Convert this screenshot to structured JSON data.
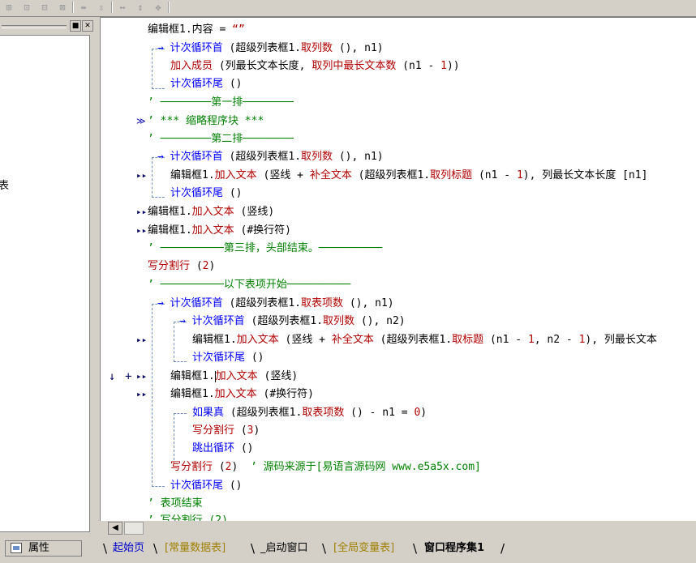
{
  "toolbar": {
    "icons": [
      "align-grid-icon",
      "align-top-icon",
      "align-middle-icon",
      "align-bottom-icon",
      "space-horizontal-icon",
      "space-vertical-icon",
      "width-icon",
      "height-icon",
      "size-both-icon"
    ]
  },
  "left_panel": {
    "stray_char": "表",
    "property_tab": "属性"
  },
  "tabs": [
    {
      "label": "起始页",
      "color": "#0000cc"
    },
    {
      "label": "[常量数据表]",
      "color": "#a08000"
    },
    {
      "label": "_启动窗口",
      "color": "#000000"
    },
    {
      "label": "[全局变量表]",
      "color": "#a08000"
    },
    {
      "label": "窗口程序集1",
      "color": "#000000",
      "active": true
    }
  ],
  "code": {
    "l1": {
      "a": "编辑框1.内容 = ",
      "b": "“”"
    },
    "l2": {
      "a": "计次循环首",
      "b": " (超级列表框1.",
      "c": "取列数",
      "d": " (), n1)"
    },
    "l3": {
      "a": "加入成员",
      "b": " (列最长文本长度, ",
      "c": "取列中最长文本数",
      "d": " (n1 - ",
      "e": "1",
      "f": "))"
    },
    "l4": {
      "a": "计次循环尾",
      "b": " ()"
    },
    "l5": {
      "a": "’ ────────第一排────────"
    },
    "l6": {
      "a": "’ *** 缩略程序块 ***"
    },
    "l7": {
      "a": "’ ────────第二排────────"
    },
    "l8": {
      "a": "计次循环首",
      "b": " (超级列表框1.",
      "c": "取列数",
      "d": " (), n1)"
    },
    "l9": {
      "a": "编辑框1.",
      "b": "加入文本",
      "c": " (竖线 + ",
      "d": "补全文本",
      "e": " (超级列表框1.",
      "f": "取列标题",
      "g": " (n1 - ",
      "h": "1",
      "i": "), 列最长文本长度 [n1]"
    },
    "l10": {
      "a": "计次循环尾",
      "b": " ()"
    },
    "l11": {
      "a": "编辑框1.",
      "b": "加入文本",
      "c": " (竖线)"
    },
    "l12": {
      "a": "编辑框1.",
      "b": "加入文本",
      "c": " (#换行符)"
    },
    "l13": {
      "a": "’ ──────────第三排，头部结束。──────────"
    },
    "l14": {
      "a": "写分割行",
      "b": " (",
      "c": "2",
      "d": ")"
    },
    "l15": {
      "a": "’ ──────────以下表项开始──────────"
    },
    "l16": {
      "a": "计次循环首",
      "b": " (超级列表框1.",
      "c": "取表项数",
      "d": " (), n1)"
    },
    "l17": {
      "a": "计次循环首",
      "b": " (超级列表框1.",
      "c": "取列数",
      "d": " (), n2)"
    },
    "l18": {
      "a": "编辑框1.",
      "b": "加入文本",
      "c": " (竖线 + ",
      "d": "补全文本",
      "e": " (超级列表框1.",
      "f": "取标题",
      "g": " (n1 - ",
      "h": "1",
      "i": ", n2 - ",
      "j": "1",
      "k": "), 列最长文本"
    },
    "l19": {
      "a": "计次循环尾",
      "b": " ()"
    },
    "l20": {
      "a": "编辑框1.",
      "b": "加入文本",
      "c": " (竖线)"
    },
    "l21": {
      "a": "编辑框1.",
      "b": "加入文本",
      "c": " (#换行符)"
    },
    "l22": {
      "a": "如果真",
      "b": " (超级列表框1.",
      "c": "取表项数",
      "d": " () - n1 = ",
      "e": "0",
      "f": ")"
    },
    "l23": {
      "a": "写分割行",
      "b": " (",
      "c": "3",
      "d": ")"
    },
    "l24": {
      "a": "跳出循环",
      "b": " ()"
    },
    "l25": {
      "a": "写分割行",
      "b": " (",
      "c": "2",
      "d": ")  ",
      "e": "’ 源码来源于[易语言源码网 www.e5a5x.com]"
    },
    "l26": {
      "a": "计次循环尾",
      "b": " ()"
    },
    "l27": {
      "a": "’ 表项结束"
    },
    "l28": {
      "a": "’ 写分割行 (2)"
    }
  },
  "gutter": {
    "fold_marker": "≫",
    "exec_marker": "▸▸",
    "arrow": "↓",
    "plus": "+",
    "flow_arrow": "→"
  }
}
